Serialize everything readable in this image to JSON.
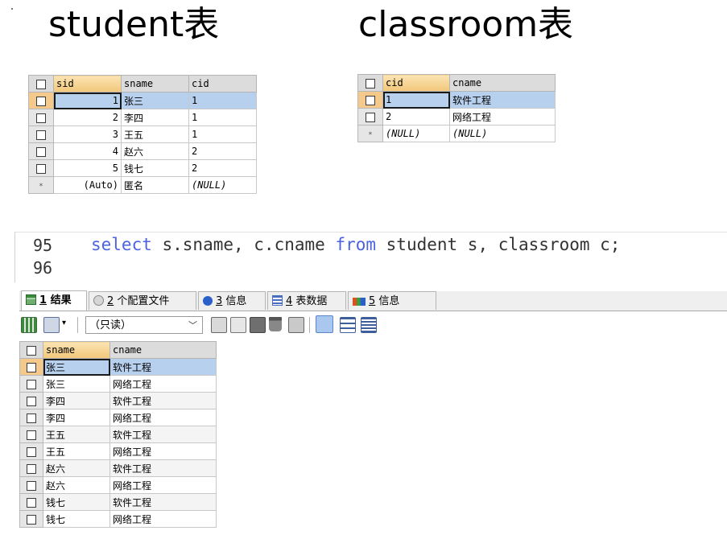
{
  "titles": {
    "student": "student表",
    "classroom": "classroom表"
  },
  "student_table": {
    "headers": [
      "sid",
      "sname",
      "cid"
    ],
    "rows": [
      [
        "1",
        "张三",
        "1"
      ],
      [
        "2",
        "李四",
        "1"
      ],
      [
        "3",
        "王五",
        "1"
      ],
      [
        "4",
        "赵六",
        "2"
      ],
      [
        "5",
        "钱七",
        "2"
      ]
    ],
    "new_row": [
      "(Auto)",
      "匿名",
      "(NULL)"
    ]
  },
  "classroom_table": {
    "headers": [
      "cid",
      "cname"
    ],
    "rows": [
      [
        "1",
        "软件工程"
      ],
      [
        "2",
        "网络工程"
      ]
    ],
    "new_row": [
      "(NULL)",
      "(NULL)"
    ]
  },
  "editor": {
    "line_numbers": [
      "95",
      "96"
    ],
    "code": {
      "kw1": "select",
      "part1": " s.sname, c.cname ",
      "kw2": "from",
      "part2": " student s, classroom c;"
    }
  },
  "result_tabs": [
    {
      "num": "1",
      "label": " 结果"
    },
    {
      "num": "2",
      "label": " 个配置文件"
    },
    {
      "num": "3",
      "label": " 信息"
    },
    {
      "num": "4",
      "label": " 表数据"
    },
    {
      "num": "5",
      "label": " 信息"
    }
  ],
  "toolbar": {
    "mode": "（只读）"
  },
  "result_table": {
    "headers": [
      "sname",
      "cname"
    ],
    "rows": [
      [
        "张三",
        "软件工程"
      ],
      [
        "张三",
        "网络工程"
      ],
      [
        "李四",
        "软件工程"
      ],
      [
        "李四",
        "网络工程"
      ],
      [
        "王五",
        "软件工程"
      ],
      [
        "王五",
        "网络工程"
      ],
      [
        "赵六",
        "软件工程"
      ],
      [
        "赵六",
        "网络工程"
      ],
      [
        "钱七",
        "软件工程"
      ],
      [
        "钱七",
        "网络工程"
      ]
    ]
  },
  "colors": {
    "selection": "#b7d0ee",
    "sorted_header": "#f2c779",
    "keyword": "#4a64e0"
  }
}
